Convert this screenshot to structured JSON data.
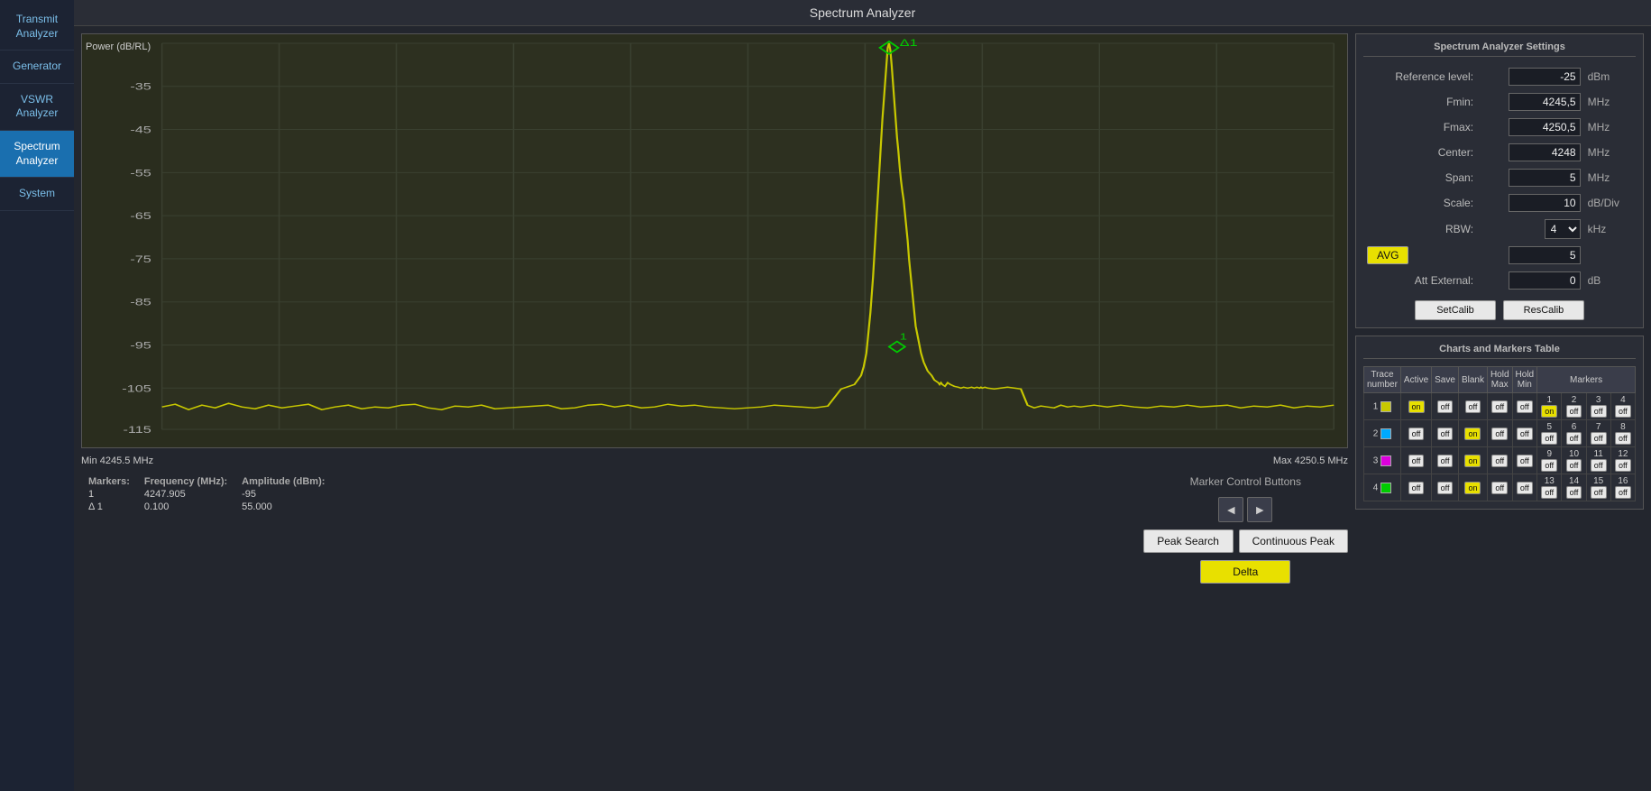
{
  "app": {
    "title": "Spectrum Analyzer"
  },
  "sidebar": {
    "items": [
      {
        "id": "transmit-analyzer",
        "label": "Transmit\nAnalyzer",
        "active": false
      },
      {
        "id": "generator",
        "label": "Generator",
        "active": false
      },
      {
        "id": "vswr-analyzer",
        "label": "VSWR\nAnalyzer",
        "active": false
      },
      {
        "id": "spectrum-analyzer",
        "label": "Spectrum\nAnalyzer",
        "active": true
      },
      {
        "id": "system",
        "label": "System",
        "active": false
      }
    ]
  },
  "chart": {
    "y_label": "Power (dB/RL)",
    "freq_min": "Min 4245.5 MHz",
    "freq_max": "Max 4250.5 MHz",
    "y_ticks": [
      "-35",
      "-45",
      "-55",
      "-65",
      "-75",
      "-85",
      "-95",
      "-105",
      "-115"
    ]
  },
  "markers": {
    "header_frequency": "Frequency (MHz):",
    "header_amplitude": "Amplitude (dBm):",
    "header_markers": "Markers:",
    "rows": [
      {
        "id": "1",
        "frequency": "4247.905",
        "amplitude": "-95"
      },
      {
        "id": "Δ 1",
        "frequency": "0.100",
        "amplitude": "55.000"
      }
    ]
  },
  "marker_controls": {
    "label": "Marker Control Buttons",
    "peak_search": "Peak Search",
    "continuous_peak": "Continuous Peak",
    "delta": "Delta",
    "nav_left": "◄",
    "nav_right": "►"
  },
  "settings": {
    "title": "Spectrum Analyzer Settings",
    "reference_level_label": "Reference level:",
    "reference_level_value": "-25",
    "reference_level_unit": "dBm",
    "fmin_label": "Fmin:",
    "fmin_value": "4245,5",
    "fmin_unit": "MHz",
    "fmax_label": "Fmax:",
    "fmax_value": "4250,5",
    "fmax_unit": "MHz",
    "center_label": "Center:",
    "center_value": "4248",
    "center_unit": "MHz",
    "span_label": "Span:",
    "span_value": "5",
    "span_unit": "MHz",
    "scale_label": "Scale:",
    "scale_value": "10",
    "scale_unit": "dB/Div",
    "rbw_label": "RBW:",
    "rbw_value": "4",
    "rbw_unit": "kHz",
    "avg_label": "AVG",
    "avg_value": "5",
    "att_external_label": "Att External:",
    "att_external_value": "0",
    "att_external_unit": "dB",
    "setcalib_label": "SetCalib",
    "rescalib_label": "ResCalib"
  },
  "charts_table": {
    "title": "Charts and Markers Table",
    "headers": {
      "trace_number": "Trace\nnumber",
      "active": "Active",
      "save": "Save",
      "blank": "Blank",
      "hold_max": "Hold\nMax",
      "hold_min": "Hold\nMin",
      "markers": "Markers"
    },
    "rows": [
      {
        "trace": "1",
        "color": "#c8c800",
        "active": "on",
        "save": "off",
        "blank": "off",
        "hold_max": "off",
        "hold_min": "off",
        "markers": [
          {
            "id": "1",
            "state": "on"
          },
          {
            "id": "2",
            "state": "off"
          },
          {
            "id": "3",
            "state": "off"
          },
          {
            "id": "4",
            "state": "off"
          }
        ]
      },
      {
        "trace": "2",
        "color": "#00aaff",
        "active": "off",
        "save": "off",
        "blank": "on",
        "hold_max": "off",
        "hold_min": "off",
        "markers": [
          {
            "id": "5",
            "state": "off"
          },
          {
            "id": "6",
            "state": "off"
          },
          {
            "id": "7",
            "state": "off"
          },
          {
            "id": "8",
            "state": "off"
          }
        ]
      },
      {
        "trace": "3",
        "color": "#dd00dd",
        "active": "off",
        "save": "off",
        "blank": "on",
        "hold_max": "off",
        "hold_min": "off",
        "markers": [
          {
            "id": "9",
            "state": "off"
          },
          {
            "id": "10",
            "state": "off"
          },
          {
            "id": "11",
            "state": "off"
          },
          {
            "id": "12",
            "state": "off"
          }
        ]
      },
      {
        "trace": "4",
        "color": "#00cc00",
        "active": "off",
        "save": "off",
        "blank": "on",
        "hold_max": "off",
        "hold_min": "off",
        "markers": [
          {
            "id": "13",
            "state": "off"
          },
          {
            "id": "14",
            "state": "off"
          },
          {
            "id": "15",
            "state": "off"
          },
          {
            "id": "16",
            "state": "off"
          }
        ]
      }
    ]
  }
}
